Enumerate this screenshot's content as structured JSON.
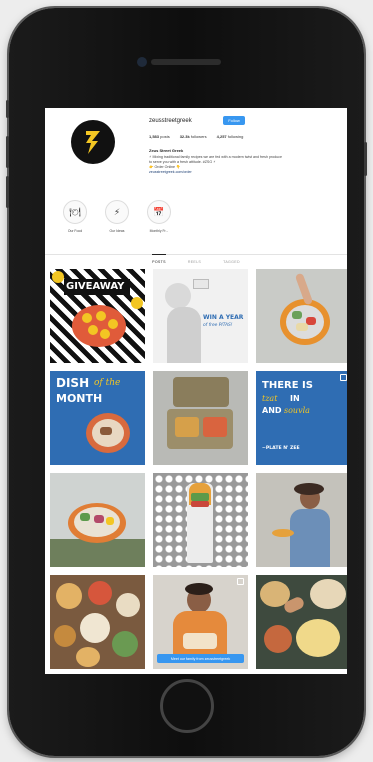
{
  "profile": {
    "username": "zeusstreetgreek",
    "follow_label": "Follow",
    "stats": [
      {
        "count": "1,583",
        "label": "posts"
      },
      {
        "count": "32.3k",
        "label": "followers"
      },
      {
        "count": "4,257",
        "label": "following"
      }
    ],
    "bio_name": "Zeus Street Greek",
    "bio_lines": [
      "⚡ Mixing traditional family recipes we are fed with a modern twist and fresh produce",
      "to serve you with a fresh attitude. #ZSG ⚡",
      "👉 Order Online 👇",
      "zeusstreetgreek.com/order"
    ]
  },
  "highlights": [
    {
      "label": "Our Food",
      "icon": "plate-icon",
      "glyph": "🍽"
    },
    {
      "label": "Our Ideas",
      "icon": "bolt-icon",
      "glyph": "⚡"
    },
    {
      "label": "Monthly Fr...",
      "icon": "calendar-icon",
      "glyph": "📅"
    }
  ],
  "tabs": [
    {
      "label": "POSTS",
      "active": true
    },
    {
      "label": "REELS",
      "active": false
    },
    {
      "label": "TAGGED",
      "active": false
    }
  ],
  "posts": {
    "giveaway": "GIVEAWAY",
    "win_a_year": "WIN A YEAR",
    "of_free_pitas": "of free PITAS!",
    "dish": "DISH",
    "of_the": "of the",
    "month": "MONTH",
    "there_is": "THERE IS",
    "tzat": "tzat",
    "in": "IN",
    "tzatziki_and": "AND",
    "souvla": "souvla",
    "plate": "~PLATE N' ZEE",
    "reel_banner": "Meet our family from zeusstreetgreek"
  },
  "colors": {
    "accent_blue": "#3897f0",
    "brand_blue": "#2f6db3",
    "brand_black": "#111111",
    "brand_yellow": "#f3c623"
  }
}
